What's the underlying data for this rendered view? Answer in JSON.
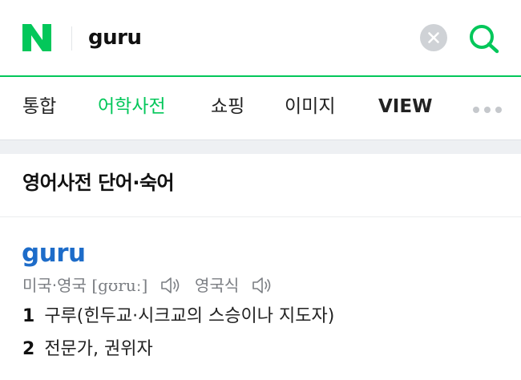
{
  "search": {
    "logo_letter": "N",
    "query": "guru"
  },
  "tabs": [
    {
      "label": "통합",
      "active": false
    },
    {
      "label": "어학사전",
      "active": true
    },
    {
      "label": "쇼핑",
      "active": false
    },
    {
      "label": "이미지",
      "active": false
    },
    {
      "label": "VIEW",
      "active": false
    }
  ],
  "section": {
    "title": "영어사전 단어·숙어"
  },
  "entry": {
    "word": "guru",
    "pronunciation_regions": "미국·영국",
    "ipa": "[gʊruː]",
    "british_label": "영국식",
    "meanings": [
      {
        "num": "1",
        "text": "구루(힌두교·시크교의 스승이나 지도자)"
      },
      {
        "num": "2",
        "text": "전문가, 권위자"
      }
    ]
  },
  "colors": {
    "brand_green": "#03c75a",
    "headword_blue": "#1d6cc9"
  }
}
